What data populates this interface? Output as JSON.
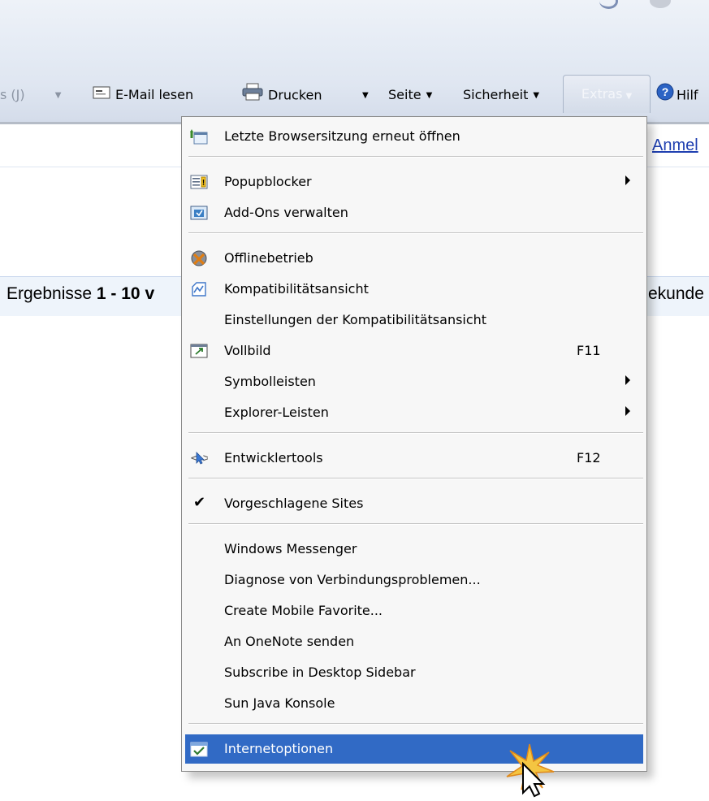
{
  "toolbar": {
    "partial_item": "s (J)",
    "read_mail": "E-Mail lesen",
    "print": "Drucken",
    "page": "Seite",
    "security": "Sicherheit",
    "tools": "Extras",
    "help_partial": "Hilf"
  },
  "page": {
    "login_link": "Anmel",
    "results_left_prefix": "Ergebnisse",
    "results_left_bold": "1 - 10",
    "results_left_tail": "v",
    "results_right": "ekunde"
  },
  "menu": {
    "items": [
      {
        "label": "Letzte Browsersitzung erneut öffnen",
        "icon": "reopen-session-icon"
      },
      {
        "label": "Popupblocker",
        "icon": "popup-blocker-icon",
        "submenu": true
      },
      {
        "label": "Add-Ons verwalten",
        "icon": "addons-icon"
      },
      {
        "label": "Offlinebetrieb",
        "icon": "offline-icon"
      },
      {
        "label": "Kompatibilitätsansicht",
        "icon": "compat-view-icon"
      },
      {
        "label": "Einstellungen der Kompatibilitätsansicht"
      },
      {
        "label": "Vollbild",
        "icon": "fullscreen-icon",
        "shortcut": "F11"
      },
      {
        "label": "Symbolleisten",
        "submenu": true
      },
      {
        "label": "Explorer-Leisten",
        "submenu": true
      },
      {
        "label": "Entwicklertools",
        "icon": "dev-tools-icon",
        "shortcut": "F12"
      },
      {
        "label": "Vorgeschlagene Sites",
        "checked": true
      },
      {
        "label": "Windows Messenger"
      },
      {
        "label": "Diagnose von Verbindungsproblemen..."
      },
      {
        "label": "Create Mobile Favorite..."
      },
      {
        "label": "An OneNote senden"
      },
      {
        "label": "Subscribe in Desktop Sidebar"
      },
      {
        "label": "Sun Java Konsole"
      },
      {
        "label": "Internetoptionen",
        "icon": "internet-options-icon",
        "highlighted": true
      }
    ]
  },
  "colors": {
    "highlight": "#316ac5",
    "link": "#1f3fb0"
  }
}
